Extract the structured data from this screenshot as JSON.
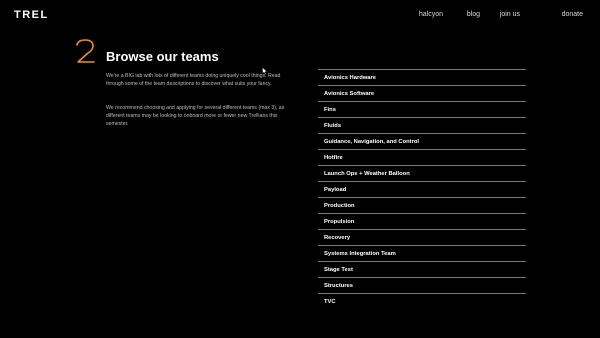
{
  "header": {
    "logo": "TREL",
    "nav": [
      "halcyon",
      "blog",
      "join us",
      "donate"
    ]
  },
  "section": {
    "number": "2",
    "accent_color": "#f08c2a",
    "title": "Browse our teams",
    "paragraph1": "We're a BIG lab with lots of different teams doing uniquely cool things. Read through some of the team descriptions to discover what suits your fancy.",
    "paragraph2": "We recommend choosing and applying for several different teams (max 3), as different teams may be looking to onboard more or fewer new Trellians this semester."
  },
  "teams": [
    "Avionics Hardware",
    "Avionics Software",
    "Fins",
    "Fluids",
    "Guidance, Navigation, and Control",
    "Hotfire",
    "Launch Ops + Weather Balloon",
    "Payload",
    "Production",
    "Propulsion",
    "Recovery",
    "Systems Integration Team",
    "Stage Test",
    "Structures",
    "TVC"
  ]
}
